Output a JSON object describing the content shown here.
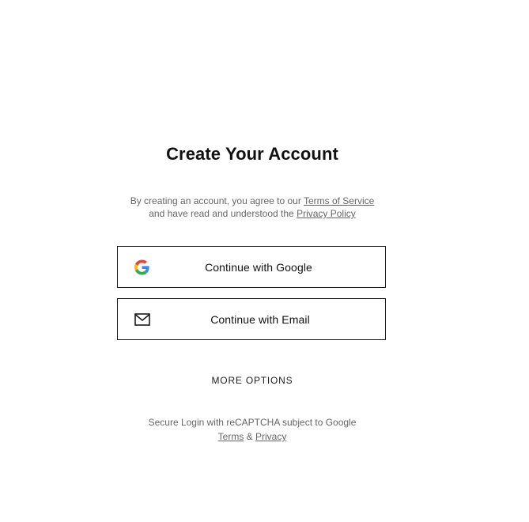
{
  "page": {
    "title": "Create Your Account"
  },
  "legal": {
    "prefix": "By creating an account, you agree to our ",
    "terms_link": "Terms of Service",
    "middle": "and have read and understood the ",
    "privacy_link": "Privacy Policy"
  },
  "buttons": {
    "google": {
      "label": "Continue with Google",
      "icon": "google-logo-icon"
    },
    "email": {
      "label": "Continue with Email",
      "icon": "envelope-icon"
    }
  },
  "more_options": {
    "label": "MORE OPTIONS"
  },
  "recaptcha": {
    "text": "Secure Login with reCAPTCHA subject to Google",
    "terms_link": "Terms",
    "separator": " & ",
    "privacy_link": "Privacy"
  },
  "colors": {
    "text": "#111111",
    "muted": "#666666",
    "border": "#1a1a1a",
    "google_blue": "#4285F4",
    "google_red": "#EA4335",
    "google_yellow": "#FBBC05",
    "google_green": "#34A853"
  }
}
